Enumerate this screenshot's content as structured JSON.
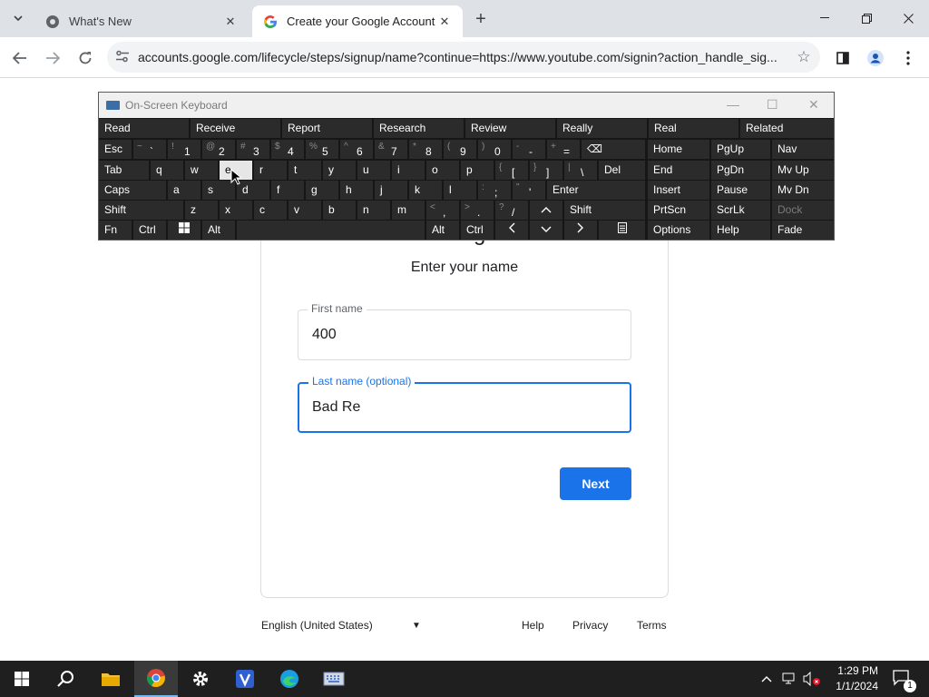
{
  "browser": {
    "tabs": [
      {
        "title": "What's New",
        "favicon": "chrome-icon",
        "active": false
      },
      {
        "title": "Create your Google Account",
        "favicon": "google-g-icon",
        "active": true
      }
    ],
    "url": "accounts.google.com/lifecycle/steps/signup/name?continue=https://www.youtube.com/signin?action_handle_sig..."
  },
  "page": {
    "heading": "Create a Google Account",
    "subheading": "Enter your name",
    "first_name": {
      "label": "First name",
      "value": "400"
    },
    "last_name": {
      "label": "Last name (optional)",
      "value": "Bad Re"
    },
    "next_button": "Next",
    "footer": {
      "language": "English (United States)",
      "help": "Help",
      "privacy": "Privacy",
      "terms": "Terms"
    }
  },
  "osk": {
    "title": "On-Screen Keyboard",
    "predictions": [
      "Read",
      "Receive",
      "Report",
      "Research",
      "Review",
      "Really",
      "Real",
      "Related"
    ],
    "row1": {
      "esc": "Esc",
      "keys": [
        {
          "s": "~",
          "p": "`"
        },
        {
          "s": "!",
          "p": "1"
        },
        {
          "s": "@",
          "p": "2"
        },
        {
          "s": "#",
          "p": "3"
        },
        {
          "s": "$",
          "p": "4"
        },
        {
          "s": "%",
          "p": "5"
        },
        {
          "s": "^",
          "p": "6"
        },
        {
          "s": "&",
          "p": "7"
        },
        {
          "s": "*",
          "p": "8"
        },
        {
          "s": "(",
          "p": "9"
        },
        {
          "s": ")",
          "p": "0"
        },
        {
          "s": "-",
          "p": "-"
        },
        {
          "s": "+",
          "p": "="
        }
      ],
      "backspace": "⌫"
    },
    "row2": {
      "tab": "Tab",
      "keys": [
        "q",
        "w",
        "e",
        "r",
        "t",
        "y",
        "u",
        "i",
        "o",
        "p"
      ],
      "brackets": [
        {
          "s": "{",
          "p": "["
        },
        {
          "s": "}",
          "p": "]"
        },
        {
          "s": "|",
          "p": "\\"
        }
      ],
      "del": "Del"
    },
    "row3": {
      "caps": "Caps",
      "keys": [
        "a",
        "s",
        "d",
        "f",
        "g",
        "h",
        "j",
        "k",
        "l"
      ],
      "punct": [
        {
          "s": ":",
          "p": ";"
        },
        {
          "s": "\"",
          "p": "'"
        }
      ],
      "enter": "Enter"
    },
    "row4": {
      "shift": "Shift",
      "keys": [
        "z",
        "x",
        "c",
        "v",
        "b",
        "n",
        "m"
      ],
      "punct": [
        {
          "s": "<",
          "p": ","
        },
        {
          "s": ">",
          "p": "."
        },
        {
          "s": "?",
          "p": "/"
        }
      ],
      "up": "^",
      "shift_r": "Shift"
    },
    "row5": {
      "fn": "Fn",
      "ctrl": "Ctrl",
      "alt": "Alt",
      "alt_r": "Alt",
      "ctrl_r": "Ctrl",
      "left": "<",
      "down": "v",
      "right": ">"
    },
    "nav": [
      [
        "Home",
        "PgUp",
        "Nav"
      ],
      [
        "End",
        "PgDn",
        "Mv Up"
      ],
      [
        "Insert",
        "Pause",
        "Mv Dn"
      ],
      [
        "PrtScn",
        "ScrLk",
        "Dock"
      ],
      [
        "Options",
        "Help",
        "Fade"
      ]
    ],
    "highlighted_key": "e"
  },
  "taskbar": {
    "time": "1:29 PM",
    "date": "1/1/2024",
    "notification_count": "1"
  }
}
